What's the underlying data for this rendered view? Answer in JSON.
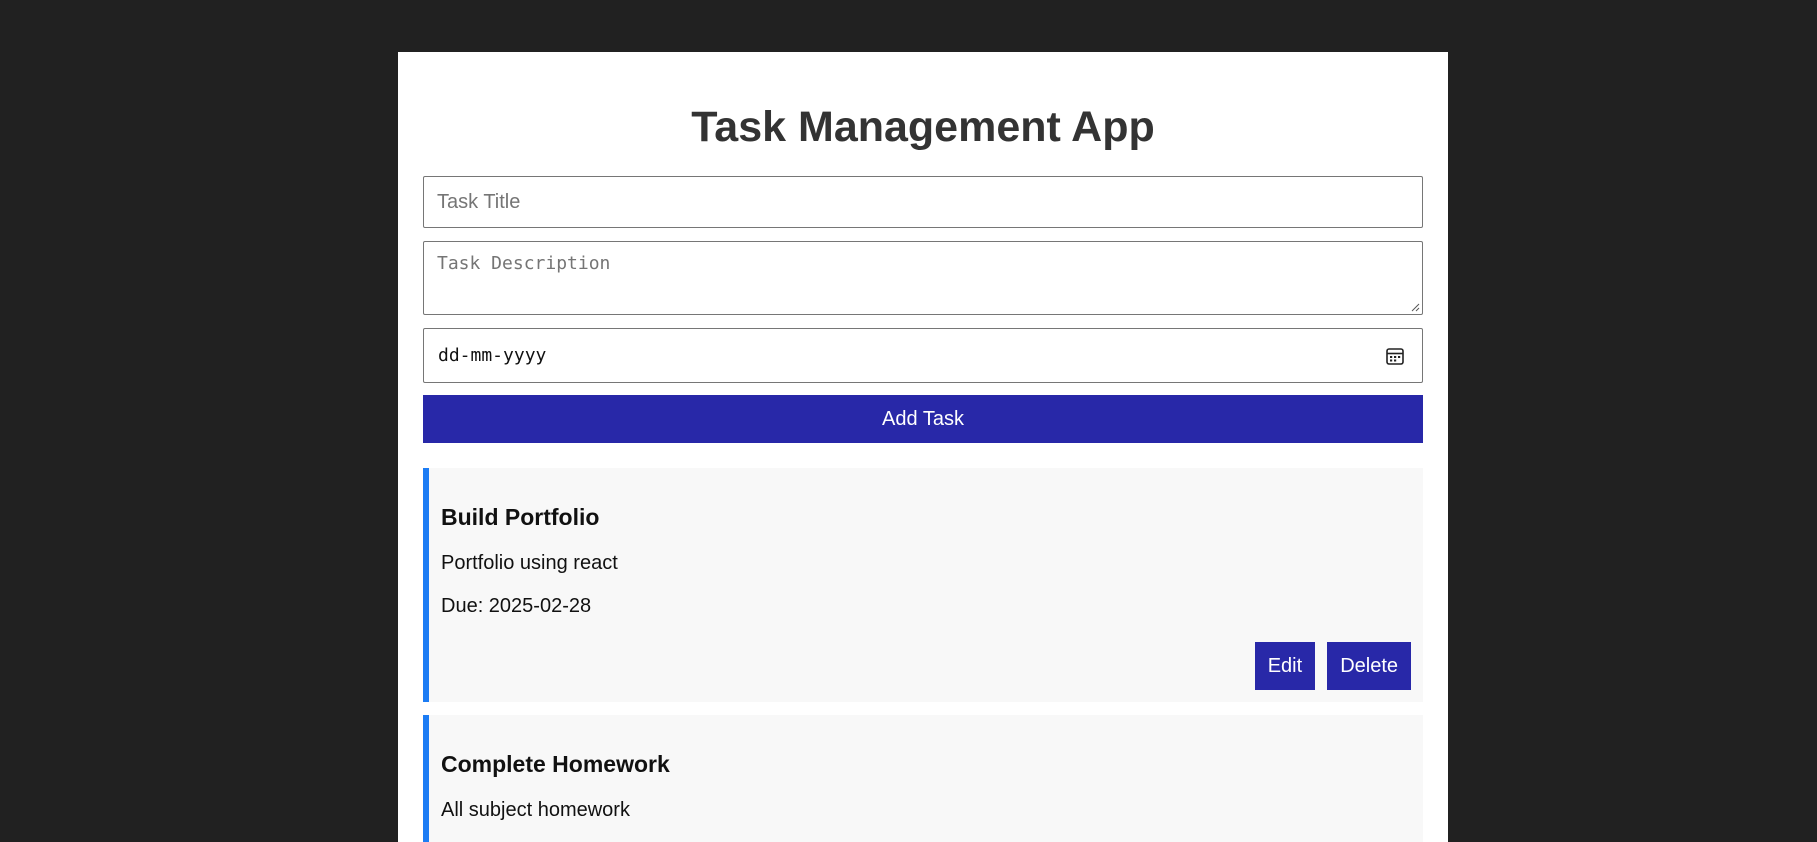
{
  "app": {
    "title": "Task Management App"
  },
  "form": {
    "title_placeholder": "Task Title",
    "description_placeholder": "Task Description",
    "date_placeholder": "dd-mm-yyyy",
    "add_button_label": "Add Task"
  },
  "tasks": [
    {
      "title": "Build Portfolio",
      "description": "Portfolio using react",
      "due": "Due: 2025-02-28",
      "edit_label": "Edit",
      "delete_label": "Delete"
    },
    {
      "title": "Complete Homework",
      "description": "All subject homework"
    }
  ],
  "colors": {
    "page_background": "#212121",
    "button": "#2828a8",
    "card_accent": "#1c7cf4",
    "card_background": "#f8f8f8"
  },
  "icons": {
    "date_picker": "calendar-icon",
    "textarea_resize": "resize-grip-icon"
  }
}
